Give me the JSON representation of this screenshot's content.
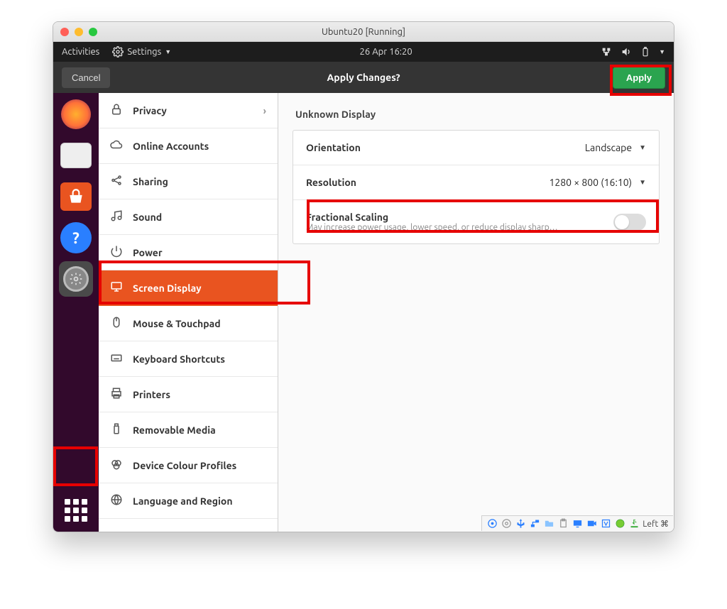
{
  "window": {
    "title": "Ubuntu20 [Running]"
  },
  "gnome": {
    "activities": "Activities",
    "app_label": "Settings",
    "clock": "26 Apr  16:20"
  },
  "applybar": {
    "cancel": "Cancel",
    "title": "Apply Changes?",
    "apply": "Apply"
  },
  "sidebar": {
    "items": [
      {
        "label": "Privacy",
        "icon": "lock",
        "chev": true
      },
      {
        "label": "Online Accounts",
        "icon": "cloud"
      },
      {
        "label": "Sharing",
        "icon": "share"
      },
      {
        "label": "Sound",
        "icon": "music"
      },
      {
        "label": "Power",
        "icon": "power"
      },
      {
        "label": "Screen Display",
        "icon": "display",
        "active": true
      },
      {
        "label": "Mouse & Touchpad",
        "icon": "mouse"
      },
      {
        "label": "Keyboard Shortcuts",
        "icon": "keyboard"
      },
      {
        "label": "Printers",
        "icon": "printer"
      },
      {
        "label": "Removable Media",
        "icon": "usb"
      },
      {
        "label": "Device Colour Profiles",
        "icon": "color"
      },
      {
        "label": "Language and Region",
        "icon": "globe"
      }
    ]
  },
  "content": {
    "heading": "Unknown Display",
    "orientation": {
      "label": "Orientation",
      "value": "Landscape"
    },
    "resolution": {
      "label": "Resolution",
      "value": "1280 × 800 (16:10)"
    },
    "scaling": {
      "label": "Fractional Scaling",
      "sub": "May increase power usage, lower speed, or reduce display sharp…",
      "on": false
    }
  },
  "status": {
    "right_label": "Left ⌘"
  }
}
